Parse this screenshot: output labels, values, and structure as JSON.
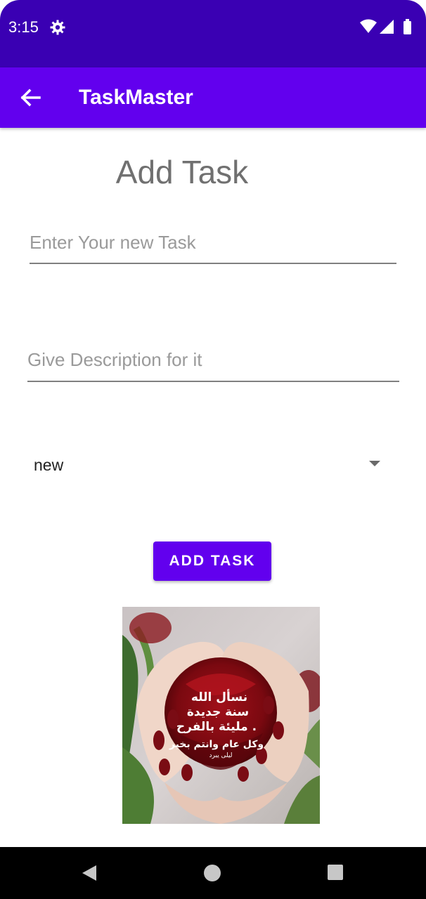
{
  "status_bar": {
    "time": "3:15",
    "icons": [
      "settings-icon",
      "wifi-icon",
      "signal-icon",
      "battery-icon"
    ],
    "color": "#3a00b3"
  },
  "app_bar": {
    "title": "TaskMaster",
    "back_icon": "arrow-back-icon",
    "color": "#6200ee"
  },
  "form": {
    "heading": "Add Task",
    "task_placeholder": "Enter Your new Task",
    "description_placeholder": "Give Description for it",
    "status_selected": "new",
    "submit_label": "ADD TASK"
  },
  "image": {
    "overlay_lines": [
      "نسأل الله",
      "سنة جديدة",
      "مليئة بالفرح .",
      "وكل عام وانتم بخير",
      "ليلى يبرد"
    ]
  },
  "nav_bar": {
    "icons": [
      "nav-back-icon",
      "nav-home-icon",
      "nav-recents-icon"
    ]
  }
}
